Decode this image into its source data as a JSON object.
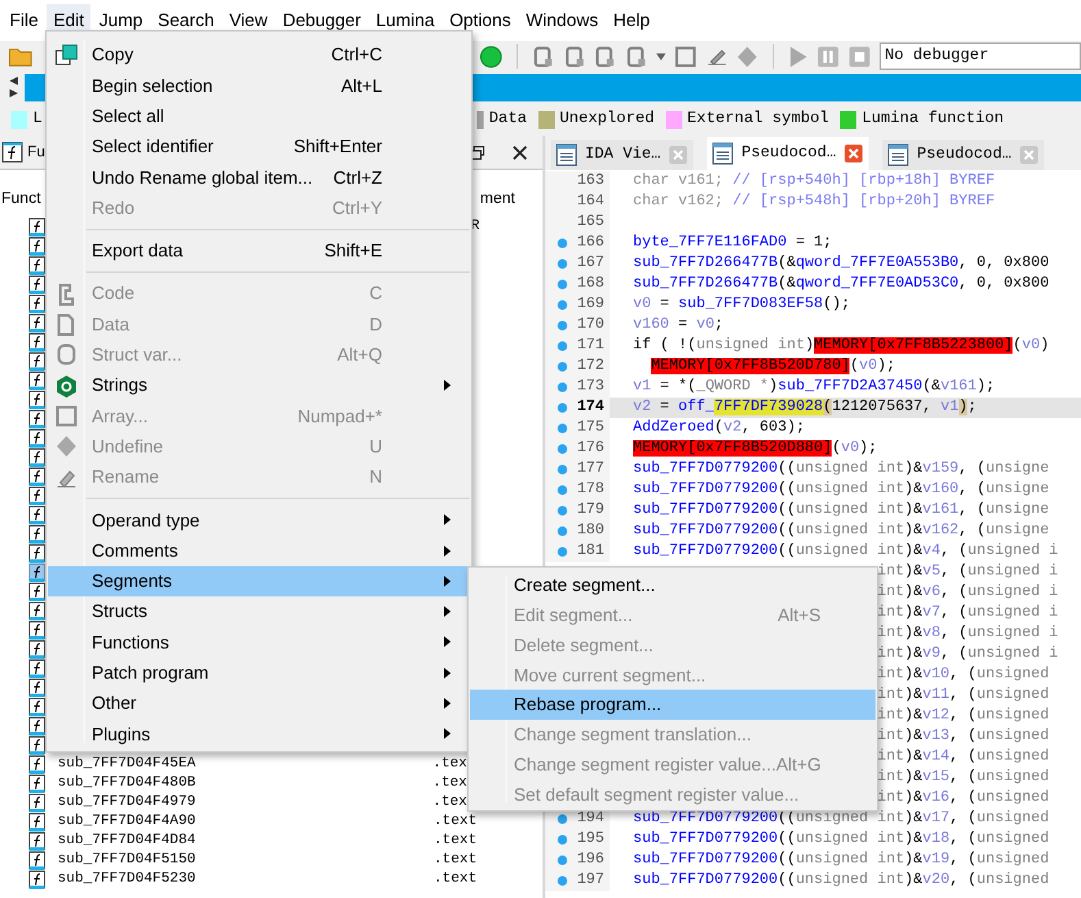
{
  "menubar": [
    {
      "label": "File",
      "selected": false
    },
    {
      "label": "Edit",
      "selected": true
    },
    {
      "label": "Jump",
      "selected": false
    },
    {
      "label": "Search",
      "selected": false
    },
    {
      "label": "View",
      "selected": false
    },
    {
      "label": "Debugger",
      "selected": false
    },
    {
      "label": "Lumina",
      "selected": false
    },
    {
      "label": "Options",
      "selected": false
    },
    {
      "label": "Windows",
      "selected": false
    },
    {
      "label": "Help",
      "selected": false
    }
  ],
  "toolbar": {
    "debugger_field": "No debugger"
  },
  "legend": [
    {
      "label": "L",
      "color": "#a8ffff"
    },
    {
      "label": "Data",
      "color": "#a0a0a0"
    },
    {
      "label": "Unexplored",
      "color": "#b4b478"
    },
    {
      "label": "External symbol",
      "color": "#ffa8ff"
    },
    {
      "label": "Lumina function",
      "color": "#30cc30"
    }
  ],
  "functions_panel": {
    "title": "Fu",
    "column_1": "Funct",
    "column_2": "ment",
    "rows": [
      {
        "segment": "R",
        "selected": false
      },
      {
        "selected": false
      },
      {
        "selected": false
      },
      {
        "selected": false
      },
      {
        "selected": false
      },
      {
        "selected": false
      },
      {
        "selected": false
      },
      {
        "selected": false
      },
      {
        "selected": false
      },
      {
        "selected": false
      },
      {
        "selected": false
      },
      {
        "selected": false
      },
      {
        "selected": false
      },
      {
        "selected": false
      },
      {
        "selected": false
      },
      {
        "selected": false
      },
      {
        "selected": false
      },
      {
        "selected": false
      },
      {
        "selected": true
      },
      {
        "selected": false
      },
      {
        "selected": false
      },
      {
        "selected": false
      },
      {
        "selected": false
      },
      {
        "selected": false
      },
      {
        "selected": false
      },
      {
        "selected": false
      },
      {
        "selected": false
      },
      {
        "selected": false
      },
      {
        "name": "sub_7FF7D04F45EA",
        "segment": ".tex",
        "selected": false
      },
      {
        "name": "sub_7FF7D04F480B",
        "segment": ".tex",
        "selected": false
      },
      {
        "name": "sub_7FF7D04F4979",
        "segment": ".tex",
        "selected": false
      },
      {
        "name": "sub_7FF7D04F4A90",
        "segment": ".text",
        "selected": false
      },
      {
        "name": "sub_7FF7D04F4D84",
        "segment": ".text",
        "selected": false
      },
      {
        "name": "sub_7FF7D04F5150",
        "segment": ".text",
        "selected": false
      },
      {
        "name": "sub_7FF7D04F5230",
        "segment": ".text",
        "selected": false
      }
    ]
  },
  "tabs": [
    {
      "label": "IDA Vie…",
      "selected": false
    },
    {
      "label": "Pseudocod…",
      "selected": true
    },
    {
      "label": "Pseudocod…",
      "selected": false
    }
  ],
  "code": [
    {
      "num": "163",
      "breakpoint": false,
      "current": false,
      "tokens": [
        {
          "kind": "decl",
          "text": "char v161; "
        },
        {
          "kind": "comment",
          "text": "// [rsp+540h] [rbp+18h] BYREF"
        }
      ]
    },
    {
      "num": "164",
      "breakpoint": false,
      "current": false,
      "tokens": [
        {
          "kind": "decl",
          "text": "char v162; "
        },
        {
          "kind": "comment",
          "text": "// [rsp+548h] [rbp+20h] BYREF"
        }
      ]
    },
    {
      "num": "165",
      "breakpoint": false,
      "current": false
    },
    {
      "num": "166",
      "breakpoint": true,
      "current": false,
      "tokens": [
        {
          "kind": "name",
          "text": "byte_7FF7E116FAD0"
        },
        {
          "kind": "plain",
          "text": " = 1;"
        }
      ]
    },
    {
      "num": "167",
      "breakpoint": true,
      "current": false,
      "tokens": [
        {
          "kind": "name",
          "text": "sub_7FF7D266477B"
        },
        {
          "kind": "plain",
          "text": "(&"
        },
        {
          "kind": "name",
          "text": "qword_7FF7E0A553B0"
        },
        {
          "kind": "plain",
          "text": ", 0, 0x800"
        }
      ]
    },
    {
      "num": "168",
      "breakpoint": true,
      "current": false,
      "tokens": [
        {
          "kind": "name",
          "text": "sub_7FF7D266477B"
        },
        {
          "kind": "plain",
          "text": "(&"
        },
        {
          "kind": "name",
          "text": "qword_7FF7E0AD53C0"
        },
        {
          "kind": "plain",
          "text": ", 0, 0x800"
        }
      ]
    },
    {
      "num": "169",
      "breakpoint": true,
      "current": false,
      "tokens": [
        {
          "kind": "var",
          "text": "v0"
        },
        {
          "kind": "plain",
          "text": " = "
        },
        {
          "kind": "name",
          "text": "sub_7FF7D083EF58"
        },
        {
          "kind": "plain",
          "text": "();"
        }
      ]
    },
    {
      "num": "170",
      "breakpoint": true,
      "current": false,
      "tokens": [
        {
          "kind": "var",
          "text": "v160"
        },
        {
          "kind": "plain",
          "text": " = "
        },
        {
          "kind": "var",
          "text": "v0"
        },
        {
          "kind": "plain",
          "text": ";"
        }
      ]
    },
    {
      "num": "171",
      "breakpoint": true,
      "current": false,
      "tokens": [
        {
          "kind": "plain",
          "text": "if ( !("
        },
        {
          "kind": "type",
          "text": "unsigned int"
        },
        {
          "kind": "plain",
          "text": ")"
        },
        {
          "kind": "mem",
          "text": "MEMORY[0x7FF8B5223800]"
        },
        {
          "kind": "plain",
          "text": "("
        },
        {
          "kind": "var",
          "text": "v0"
        },
        {
          "kind": "plain",
          "text": ")"
        }
      ]
    },
    {
      "num": "172",
      "breakpoint": true,
      "current": false,
      "indented": true,
      "tokens": [
        {
          "kind": "mem",
          "text": "MEMORY[0x7FF8B520D780]"
        },
        {
          "kind": "plain",
          "text": "("
        },
        {
          "kind": "var",
          "text": "v0"
        },
        {
          "kind": "plain",
          "text": ");"
        }
      ]
    },
    {
      "num": "173",
      "breakpoint": true,
      "current": false,
      "tokens": [
        {
          "kind": "var",
          "text": "v1"
        },
        {
          "kind": "plain",
          "text": " = *("
        },
        {
          "kind": "type",
          "text": "_QWORD *"
        },
        {
          "kind": "plain",
          "text": ")"
        },
        {
          "kind": "name",
          "text": "sub_7FF7D2A37450"
        },
        {
          "kind": "plain",
          "text": "(&"
        },
        {
          "kind": "var",
          "text": "v161"
        },
        {
          "kind": "plain",
          "text": ");"
        }
      ]
    },
    {
      "num": "174",
      "breakpoint": true,
      "current": true,
      "tokens": [
        {
          "kind": "var",
          "text": "v2"
        },
        {
          "kind": "plain",
          "text": " = "
        },
        {
          "kind": "name",
          "text": "off_"
        },
        {
          "kind": "highlight",
          "text": "7FF7DF739028"
        },
        {
          "kind": "match",
          "text": "("
        },
        {
          "kind": "plain",
          "text": "1212075637, "
        },
        {
          "kind": "var",
          "text": "v1"
        },
        {
          "kind": "match",
          "text": ")"
        },
        {
          "kind": "plain",
          "text": ";"
        }
      ]
    },
    {
      "num": "175",
      "breakpoint": true,
      "current": false,
      "tokens": [
        {
          "kind": "name",
          "text": "AddZeroed"
        },
        {
          "kind": "plain",
          "text": "("
        },
        {
          "kind": "var",
          "text": "v2"
        },
        {
          "kind": "plain",
          "text": ", 603);"
        }
      ]
    },
    {
      "num": "176",
      "breakpoint": true,
      "current": false,
      "tokens": [
        {
          "kind": "mem",
          "text": "MEMORY[0x7FF8B520D880]"
        },
        {
          "kind": "plain",
          "text": "("
        },
        {
          "kind": "var",
          "text": "v0"
        },
        {
          "kind": "plain",
          "text": ");"
        }
      ]
    },
    {
      "num": "177",
      "breakpoint": true,
      "current": false,
      "tokens": [
        {
          "kind": "name",
          "text": "sub_7FF7D0779200"
        },
        {
          "kind": "plain",
          "text": "(("
        },
        {
          "kind": "type",
          "text": "unsigned int"
        },
        {
          "kind": "plain",
          "text": ")&"
        },
        {
          "kind": "var",
          "text": "v159"
        },
        {
          "kind": "plain",
          "text": ", ("
        },
        {
          "kind": "type",
          "text": "unsigne"
        }
      ]
    },
    {
      "num": "178",
      "breakpoint": true,
      "current": false,
      "tokens": [
        {
          "kind": "name",
          "text": "sub_7FF7D0779200"
        },
        {
          "kind": "plain",
          "text": "(("
        },
        {
          "kind": "type",
          "text": "unsigned int"
        },
        {
          "kind": "plain",
          "text": ")&"
        },
        {
          "kind": "var",
          "text": "v160"
        },
        {
          "kind": "plain",
          "text": ", ("
        },
        {
          "kind": "type",
          "text": "unsigne"
        }
      ]
    },
    {
      "num": "179",
      "breakpoint": true,
      "current": false,
      "tokens": [
        {
          "kind": "name",
          "text": "sub_7FF7D0779200"
        },
        {
          "kind": "plain",
          "text": "(("
        },
        {
          "kind": "type",
          "text": "unsigned int"
        },
        {
          "kind": "plain",
          "text": ")&"
        },
        {
          "kind": "var",
          "text": "v161"
        },
        {
          "kind": "plain",
          "text": ", ("
        },
        {
          "kind": "type",
          "text": "unsigne"
        }
      ]
    },
    {
      "num": "180",
      "breakpoint": true,
      "current": false,
      "tokens": [
        {
          "kind": "name",
          "text": "sub_7FF7D0779200"
        },
        {
          "kind": "plain",
          "text": "(("
        },
        {
          "kind": "type",
          "text": "unsigned int"
        },
        {
          "kind": "plain",
          "text": ")&"
        },
        {
          "kind": "var",
          "text": "v162"
        },
        {
          "kind": "plain",
          "text": ", ("
        },
        {
          "kind": "type",
          "text": "unsigne"
        }
      ]
    },
    {
      "num": "181",
      "breakpoint": true,
      "current": false,
      "tokens": [
        {
          "kind": "name",
          "text": "sub_7FF7D0779200"
        },
        {
          "kind": "plain",
          "text": "(("
        },
        {
          "kind": "type",
          "text": "unsigned int"
        },
        {
          "kind": "plain",
          "text": ")&"
        },
        {
          "kind": "var",
          "text": "v4"
        },
        {
          "kind": "plain",
          "text": ", ("
        },
        {
          "kind": "type",
          "text": "unsigned i"
        }
      ]
    },
    {
      "covered": true,
      "tokens": [
        {
          "kind": "type",
          "text": "int"
        },
        {
          "kind": "plain",
          "text": ")&"
        },
        {
          "kind": "var",
          "text": "v5"
        },
        {
          "kind": "plain",
          "text": ", ("
        },
        {
          "kind": "type",
          "text": "unsigned i"
        }
      ]
    },
    {
      "covered": true,
      "tokens": [
        {
          "kind": "type",
          "text": "int"
        },
        {
          "kind": "plain",
          "text": ")&"
        },
        {
          "kind": "var",
          "text": "v6"
        },
        {
          "kind": "plain",
          "text": ", ("
        },
        {
          "kind": "type",
          "text": "unsigned i"
        }
      ]
    },
    {
      "covered": true,
      "tokens": [
        {
          "kind": "type",
          "text": "int"
        },
        {
          "kind": "plain",
          "text": ")&"
        },
        {
          "kind": "var",
          "text": "v7"
        },
        {
          "kind": "plain",
          "text": ", ("
        },
        {
          "kind": "type",
          "text": "unsigned i"
        }
      ]
    },
    {
      "covered": true,
      "tokens": [
        {
          "kind": "type",
          "text": "int"
        },
        {
          "kind": "plain",
          "text": ")&"
        },
        {
          "kind": "var",
          "text": "v8"
        },
        {
          "kind": "plain",
          "text": ", ("
        },
        {
          "kind": "type",
          "text": "unsigned i"
        }
      ]
    },
    {
      "covered": true,
      "tokens": [
        {
          "kind": "type",
          "text": "int"
        },
        {
          "kind": "plain",
          "text": ")&"
        },
        {
          "kind": "var",
          "text": "v9"
        },
        {
          "kind": "plain",
          "text": ", ("
        },
        {
          "kind": "type",
          "text": "unsigned i"
        }
      ]
    },
    {
      "covered": true,
      "tokens": [
        {
          "kind": "type",
          "text": "int"
        },
        {
          "kind": "plain",
          "text": ")&"
        },
        {
          "kind": "var",
          "text": "v10"
        },
        {
          "kind": "plain",
          "text": ", ("
        },
        {
          "kind": "type",
          "text": "unsigned"
        }
      ]
    },
    {
      "covered": true,
      "tokens": [
        {
          "kind": "type",
          "text": "int"
        },
        {
          "kind": "plain",
          "text": ")&"
        },
        {
          "kind": "var",
          "text": "v11"
        },
        {
          "kind": "plain",
          "text": ", ("
        },
        {
          "kind": "type",
          "text": "unsigned"
        }
      ]
    },
    {
      "covered": true,
      "tokens": [
        {
          "kind": "type",
          "text": "int"
        },
        {
          "kind": "plain",
          "text": ")&"
        },
        {
          "kind": "var",
          "text": "v12"
        },
        {
          "kind": "plain",
          "text": ", ("
        },
        {
          "kind": "type",
          "text": "unsigned"
        }
      ]
    },
    {
      "covered": true,
      "tokens": [
        {
          "kind": "type",
          "text": "int"
        },
        {
          "kind": "plain",
          "text": ")&"
        },
        {
          "kind": "var",
          "text": "v13"
        },
        {
          "kind": "plain",
          "text": ", ("
        },
        {
          "kind": "type",
          "text": "unsigned"
        }
      ]
    },
    {
      "covered": true,
      "tokens": [
        {
          "kind": "type",
          "text": "int"
        },
        {
          "kind": "plain",
          "text": ")&"
        },
        {
          "kind": "var",
          "text": "v14"
        },
        {
          "kind": "plain",
          "text": ", ("
        },
        {
          "kind": "type",
          "text": "unsigned"
        }
      ]
    },
    {
      "covered": true,
      "tokens": [
        {
          "kind": "type",
          "text": "int"
        },
        {
          "kind": "plain",
          "text": ")&"
        },
        {
          "kind": "var",
          "text": "v15"
        },
        {
          "kind": "plain",
          "text": ", ("
        },
        {
          "kind": "type",
          "text": "unsigned"
        }
      ]
    },
    {
      "covered": true,
      "tokens": [
        {
          "kind": "type",
          "text": "int"
        },
        {
          "kind": "plain",
          "text": ")&"
        },
        {
          "kind": "var",
          "text": "v16"
        },
        {
          "kind": "plain",
          "text": ", ("
        },
        {
          "kind": "type",
          "text": "unsigned"
        }
      ]
    },
    {
      "num": "194",
      "breakpoint": true,
      "current": false,
      "tokens": [
        {
          "kind": "name",
          "text": "sub_7FF7D0779200"
        },
        {
          "kind": "plain",
          "text": "(("
        },
        {
          "kind": "type",
          "text": "unsigned int"
        },
        {
          "kind": "plain",
          "text": ")&"
        },
        {
          "kind": "var",
          "text": "v17"
        },
        {
          "kind": "plain",
          "text": ", ("
        },
        {
          "kind": "type",
          "text": "unsigned"
        }
      ]
    },
    {
      "num": "195",
      "breakpoint": true,
      "current": false,
      "tokens": [
        {
          "kind": "name",
          "text": "sub_7FF7D0779200"
        },
        {
          "kind": "plain",
          "text": "(("
        },
        {
          "kind": "type",
          "text": "unsigned int"
        },
        {
          "kind": "plain",
          "text": ")&"
        },
        {
          "kind": "var",
          "text": "v18"
        },
        {
          "kind": "plain",
          "text": ", ("
        },
        {
          "kind": "type",
          "text": "unsigned"
        }
      ]
    },
    {
      "num": "196",
      "breakpoint": true,
      "current": false,
      "tokens": [
        {
          "kind": "name",
          "text": "sub_7FF7D0779200"
        },
        {
          "kind": "plain",
          "text": "(("
        },
        {
          "kind": "type",
          "text": "unsigned int"
        },
        {
          "kind": "plain",
          "text": ")&"
        },
        {
          "kind": "var",
          "text": "v19"
        },
        {
          "kind": "plain",
          "text": ", ("
        },
        {
          "kind": "type",
          "text": "unsigned"
        }
      ]
    },
    {
      "num": "197",
      "breakpoint": true,
      "current": false,
      "tokens": [
        {
          "kind": "name",
          "text": "sub_7FF7D0779200"
        },
        {
          "kind": "plain",
          "text": "(("
        },
        {
          "kind": "type",
          "text": "unsigned int"
        },
        {
          "kind": "plain",
          "text": ")&"
        },
        {
          "kind": "var",
          "text": "v20"
        },
        {
          "kind": "plain",
          "text": ", ("
        },
        {
          "kind": "type",
          "text": "unsigned"
        }
      ]
    }
  ],
  "edit_menu": [
    {
      "label": "Copy",
      "shortcut": "Ctrl+C",
      "disabled": false,
      "submenu": false,
      "selected": false
    },
    {
      "label": "Begin selection",
      "shortcut": "Alt+L",
      "disabled": false,
      "submenu": false,
      "selected": false
    },
    {
      "label": "Select all",
      "disabled": false,
      "submenu": false,
      "selected": false
    },
    {
      "label": "Select identifier",
      "shortcut": "Shift+Enter",
      "disabled": false,
      "submenu": false,
      "selected": false
    },
    {
      "label": "Undo Rename global item...",
      "shortcut": "Ctrl+Z",
      "disabled": false,
      "submenu": false,
      "selected": false
    },
    {
      "label": "Redo",
      "shortcut": "Ctrl+Y",
      "disabled": true,
      "submenu": false,
      "selected": false
    },
    {
      "kind": "separator"
    },
    {
      "label": "Export data",
      "shortcut": "Shift+E",
      "disabled": false,
      "submenu": false,
      "selected": false
    },
    {
      "kind": "separator"
    },
    {
      "label": "Code",
      "shortcut": "C",
      "disabled": true,
      "submenu": false,
      "selected": false
    },
    {
      "label": "Data",
      "shortcut": "D",
      "disabled": true,
      "submenu": false,
      "selected": false
    },
    {
      "label": "Struct var...",
      "shortcut": "Alt+Q",
      "disabled": true,
      "submenu": false,
      "selected": false
    },
    {
      "label": "Strings",
      "disabled": false,
      "submenu": true,
      "selected": false
    },
    {
      "label": "Array...",
      "shortcut": "Numpad+*",
      "disabled": true,
      "submenu": false,
      "selected": false
    },
    {
      "label": "Undefine",
      "shortcut": "U",
      "disabled": true,
      "submenu": false,
      "selected": false
    },
    {
      "label": "Rename",
      "shortcut": "N",
      "disabled": true,
      "submenu": false,
      "selected": false
    },
    {
      "kind": "separator"
    },
    {
      "label": "Operand type",
      "disabled": false,
      "submenu": true,
      "selected": false
    },
    {
      "label": "Comments",
      "disabled": false,
      "submenu": true,
      "selected": false
    },
    {
      "label": "Segments",
      "disabled": false,
      "submenu": true,
      "selected": true
    },
    {
      "label": "Structs",
      "disabled": false,
      "submenu": true,
      "selected": false
    },
    {
      "label": "Functions",
      "disabled": false,
      "submenu": true,
      "selected": false
    },
    {
      "label": "Patch program",
      "disabled": false,
      "submenu": true,
      "selected": false
    },
    {
      "label": "Other",
      "disabled": false,
      "submenu": true,
      "selected": false
    },
    {
      "label": "Plugins",
      "disabled": false,
      "submenu": true,
      "selected": false
    }
  ],
  "segments_submenu": [
    {
      "label": "Create segment...",
      "disabled": false,
      "selected": false
    },
    {
      "label": "Edit segment...",
      "shortcut": "Alt+S",
      "disabled": true,
      "selected": false
    },
    {
      "label": "Delete segment...",
      "disabled": true,
      "selected": false
    },
    {
      "label": "Move current segment...",
      "disabled": true,
      "selected": false
    },
    {
      "label": "Rebase program...",
      "disabled": false,
      "selected": true
    },
    {
      "label": "Change segment translation...",
      "disabled": true,
      "selected": false
    },
    {
      "label": "Change segment register value...",
      "shortcut": "Alt+G",
      "disabled": true,
      "selected": false
    },
    {
      "label": "Set default segment register value...",
      "disabled": true,
      "selected": false
    }
  ]
}
